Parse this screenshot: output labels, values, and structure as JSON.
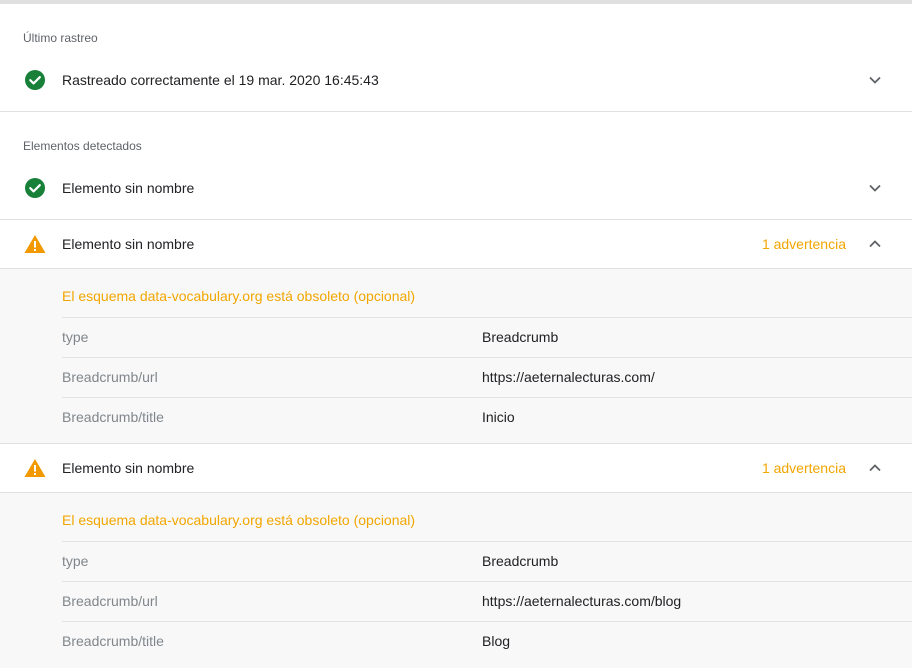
{
  "last_crawl": {
    "section_label": "Último rastreo",
    "status_text": "Rastreado correctamente el 19 mar. 2020 16:45:43",
    "status_icon": "check-circle-icon"
  },
  "detected": {
    "section_label": "Elementos detectados",
    "items": [
      {
        "label": "Elemento sin nombre",
        "status": "valid",
        "icon": "check-circle-icon"
      },
      {
        "label": "Elemento sin nombre",
        "status": "warning",
        "icon": "warning-triangle-icon",
        "warning_count": "1 advertencia",
        "warning_title": "El esquema data-vocabulary.org está obsoleto (opcional)",
        "properties": [
          {
            "key": "type",
            "value": "Breadcrumb"
          },
          {
            "key": "Breadcrumb/url",
            "value": "https://aeternalecturas.com/"
          },
          {
            "key": "Breadcrumb/title",
            "value": "Inicio"
          }
        ]
      },
      {
        "label": "Elemento sin nombre",
        "status": "warning",
        "icon": "warning-triangle-icon",
        "warning_count": "1 advertencia",
        "warning_title": "El esquema data-vocabulary.org está obsoleto (opcional)",
        "properties": [
          {
            "key": "type",
            "value": "Breadcrumb"
          },
          {
            "key": "Breadcrumb/url",
            "value": "https://aeternalecturas.com/blog"
          },
          {
            "key": "Breadcrumb/title",
            "value": "Blog"
          }
        ]
      }
    ]
  },
  "colors": {
    "success": "#188038",
    "warning": "#f2a600",
    "warning_icon": "#f29900"
  }
}
